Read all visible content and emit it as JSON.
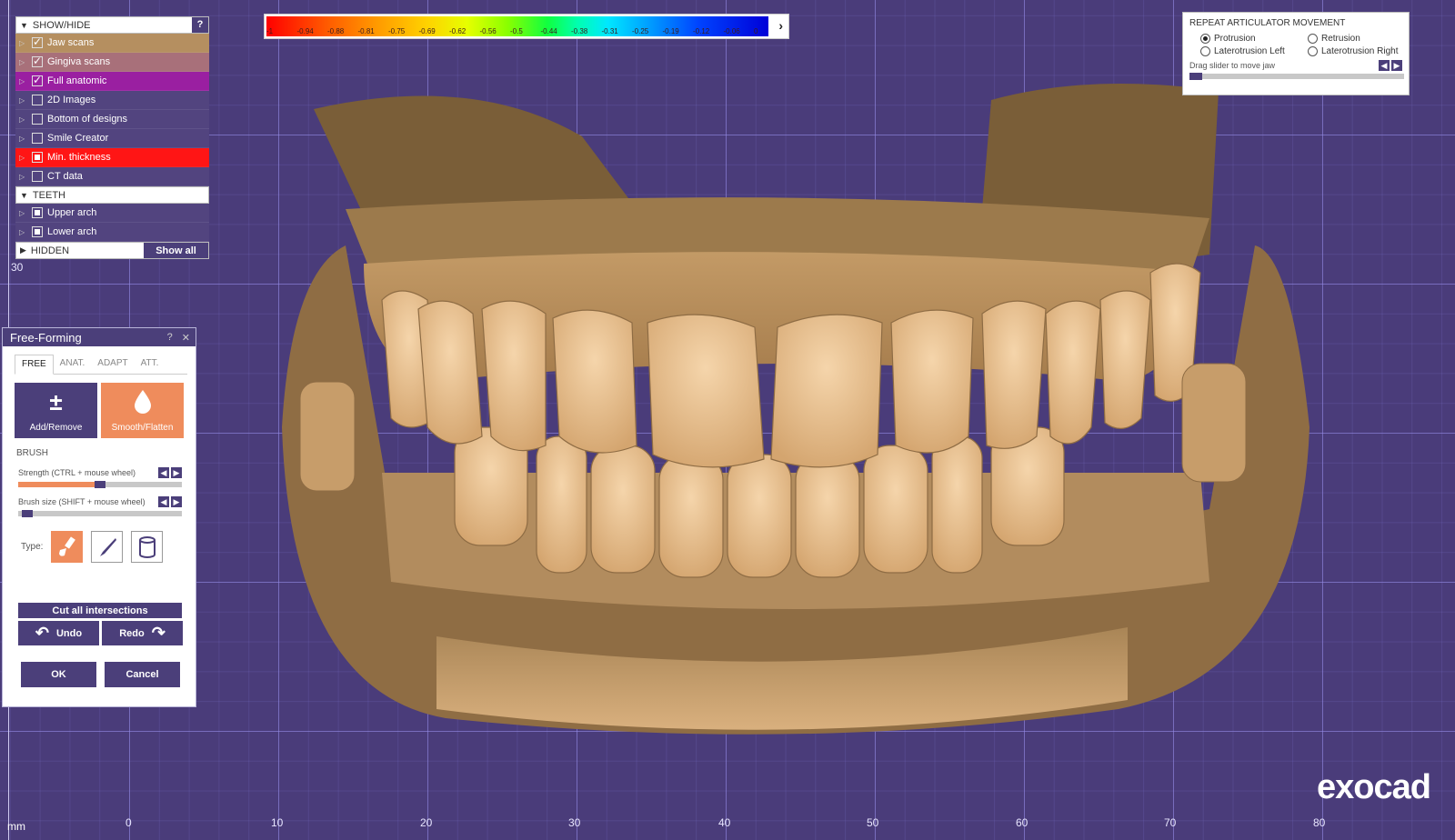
{
  "colorscale": {
    "labels": [
      "-1",
      "-0.94",
      "-0.88",
      "-0.81",
      "-0.75",
      "-0.69",
      "-0.62",
      "-0.56",
      "-0.5",
      "-0.44",
      "-0.38",
      "-0.31",
      "-0.25",
      "-0.19",
      "-0.12",
      "-0.06",
      "0"
    ],
    "arrow": "›"
  },
  "showhide": {
    "header": "SHOW/HIDE",
    "help": "?",
    "items": [
      {
        "label": "Jaw scans",
        "color": "#b58f60",
        "state": "checked"
      },
      {
        "label": "Gingiva scans",
        "color": "#a8707a",
        "state": "checked"
      },
      {
        "label": "Full anatomic",
        "color": "#9a1fa1",
        "state": "checked"
      },
      {
        "label": "2D Images",
        "color": "#52447f",
        "state": "unchecked"
      },
      {
        "label": "Bottom of designs",
        "color": "#52447f",
        "state": "unchecked"
      },
      {
        "label": "Smile Creator",
        "color": "#52447f",
        "state": "unchecked"
      },
      {
        "label": "Min. thickness",
        "color": "#ff1515",
        "state": "filled"
      },
      {
        "label": "CT data",
        "color": "#52447f",
        "state": "unchecked"
      }
    ],
    "teeth_header": "TEETH",
    "teeth_items": [
      {
        "label": "Upper arch",
        "color": "#52447f",
        "state": "filled"
      },
      {
        "label": "Lower arch",
        "color": "#52447f",
        "state": "filled"
      }
    ],
    "hidden_label": "HIDDEN",
    "show_all": "Show all"
  },
  "freeform": {
    "title": "Free-Forming",
    "help": "?",
    "close": "✕",
    "tabs": [
      "FREE",
      "ANAT.",
      "ADAPT",
      "ATT."
    ],
    "active_tab": 0,
    "tool_add": "Add/Remove",
    "tool_smooth": "Smooth/Flatten",
    "brush_label": "BRUSH",
    "strength_label": "Strength (CTRL + mouse wheel)",
    "strength_value": 0.5,
    "brushsize_label": "Brush size (SHIFT + mouse wheel)",
    "brushsize_value": 0.02,
    "type_label": "Type:",
    "cut_all": "Cut all intersections",
    "undo": "Undo",
    "redo": "Redo",
    "ok": "OK",
    "cancel": "Cancel"
  },
  "articulator": {
    "title": "REPEAT ARTICULATOR MOVEMENT",
    "options": [
      "Protrusion",
      "Retrusion",
      "Laterotrusion Left",
      "Laterotrusion Right"
    ],
    "selected": 0,
    "drag_label": "Drag slider to move jaw"
  },
  "ruler": {
    "unit": "mm",
    "x_ticks": [
      "0",
      "10",
      "20",
      "30",
      "40",
      "50",
      "60",
      "70",
      "80"
    ],
    "y_tick": "30"
  },
  "brand": "exocad"
}
